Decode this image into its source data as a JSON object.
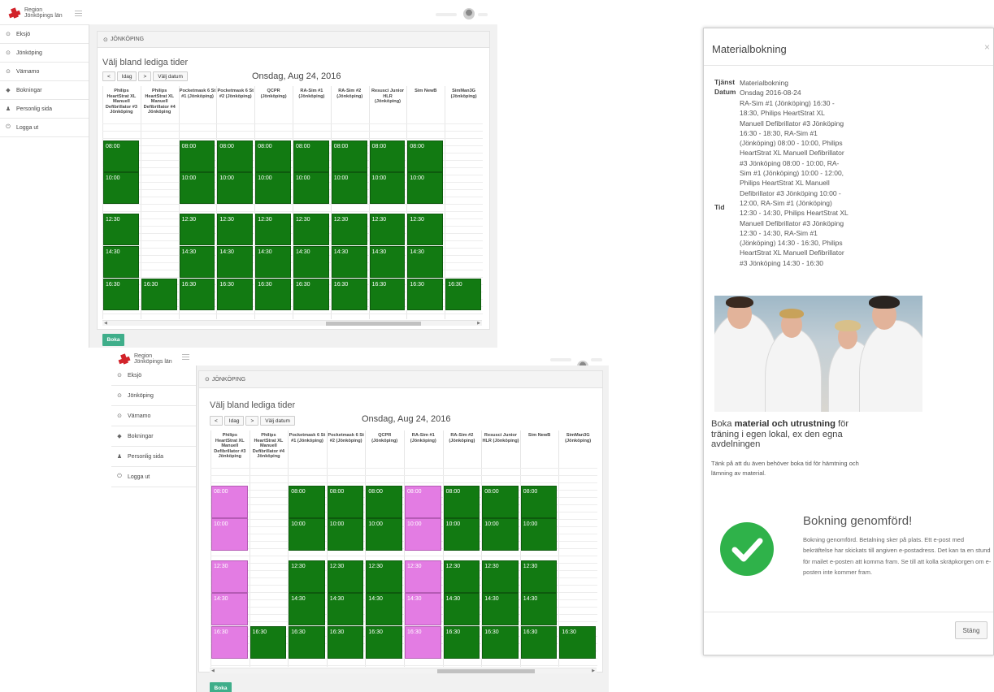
{
  "brand": {
    "line1": "Region",
    "line2": "Jönköpings län",
    "accent": "#d2232a"
  },
  "sidebar": {
    "items": [
      {
        "label": "Eksjö",
        "icon": "clock-icon"
      },
      {
        "label": "Jönköping",
        "icon": "clock-icon"
      },
      {
        "label": "Värnamo",
        "icon": "clock-icon"
      },
      {
        "label": "Bokningar",
        "icon": "tag-icon"
      },
      {
        "label": "Personlig sida",
        "icon": "user-icon"
      },
      {
        "label": "Logga ut",
        "icon": "power-icon"
      }
    ]
  },
  "booking": {
    "location": "JÖNKÖPING",
    "heading": "Välj bland lediga tider",
    "buttons": {
      "prev": "<",
      "today": "Idag",
      "next": ">",
      "pick_date": "Välj datum"
    },
    "date": "Onsdag, Aug 24, 2016",
    "submit_label": "Boka",
    "resources": [
      "Philips HeartStrat XL Manuell Defibrillator #3 Jönköping",
      "Philips HeartStrat XL Manuell Defibrillator #4 Jönköping",
      "Pocketmask 6 St #1 (Jönköping)",
      "Pocketmask 6 St #2 (Jönköping)",
      "QCPR (Jönköping)",
      "RA-Sim #1 (Jönköping)",
      "RA-Sim #2 (Jönköping)",
      "Resusci Junior HLR (Jönköping)",
      "Sim NewB",
      "SimMan3G (Jönköping)"
    ],
    "times": [
      "08:00",
      "10:00",
      "12:30",
      "14:30",
      "16:30"
    ]
  },
  "modal": {
    "title": "Materialbokning",
    "close": "×",
    "service_label": "Tjänst",
    "service_value": "Materialbokning",
    "date_label": "Datum",
    "date_value": "Onsdag 2016-08-24",
    "time_label": "Tid",
    "time_value": "RA-Sim #1 (Jönköping) 16:30 - 18:30, Philips HeartStrat XL Manuell Defibrillator #3 Jönköping 16:30 - 18:30, RA-Sim #1 (Jönköping) 08:00 - 10:00, Philips HeartStrat XL Manuell Defibrillator #3 Jönköping 08:00 - 10:00, RA-Sim #1 (Jönköping) 10:00 - 12:00, Philips HeartStrat XL Manuell Defibrillator #3 Jönköping 10:00 - 12:00, RA-Sim #1 (Jönköping) 12:30 - 14:30, Philips HeartStrat XL Manuell Defibrillator #3 Jönköping 12:30 - 14:30, RA-Sim #1 (Jönköping) 14:30 - 16:30, Philips HeartStrat XL Manuell Defibrillator #3 Jönköping 14:30 - 16:30",
    "promo_pre": "Boka ",
    "promo_bold": "material och utrustning",
    "promo_post": " för träning i egen lokal, ex den egna avdelningen",
    "note": "Tänk på att du även behöver boka tid för hämtning och lämning av material.",
    "done_title": "Bokning genomförd!",
    "done_text": "Bokning genomförd. Betalning sker på plats. Ett e-post med bekräftelse har skickats till angiven e-postadress. Det kan ta en stund för mailet e-posten att komma fram. Se till att kolla skräpkorgen om e-posten inte kommer fram.",
    "close_button": "Stäng"
  },
  "colors": {
    "free": "#127a12",
    "selected": "#e37ce3",
    "button": "#3fae8a"
  }
}
